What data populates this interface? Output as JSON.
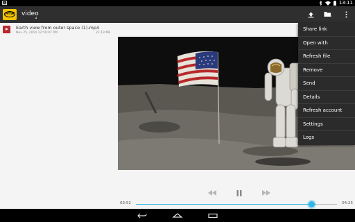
{
  "status_bar": {
    "time": "13:11",
    "icons": [
      "bluetooth-icon",
      "wifi-icon",
      "battery-icon"
    ]
  },
  "action_bar": {
    "app_logo_text": "MTN",
    "title": "video",
    "actions": [
      "upload-icon",
      "folder-icon",
      "overflow-menu-icon"
    ]
  },
  "file": {
    "name": "Earth view from outer space (1).mp4",
    "date": "Nov 25, 2014 12:50:07 PM",
    "size": "22.19 MB"
  },
  "player": {
    "current_time": "03:52",
    "duration": "04:25",
    "progress": 0.875,
    "controls": [
      "rewind-icon",
      "pause-icon",
      "fast-forward-icon"
    ]
  },
  "menu": {
    "items": [
      "Share link",
      "Open with",
      "Refresh file",
      "Remove",
      "Send",
      "Details",
      "Refresh account",
      "Settings",
      "Logs"
    ]
  },
  "nav_bar": {
    "buttons": [
      "back-icon",
      "home-icon",
      "recents-icon"
    ]
  },
  "colors": {
    "accent": "#33b5e5",
    "action_bar": "#2f2f2f",
    "menu_bg": "#2b2b2b",
    "brand_yellow": "#f5c400"
  }
}
